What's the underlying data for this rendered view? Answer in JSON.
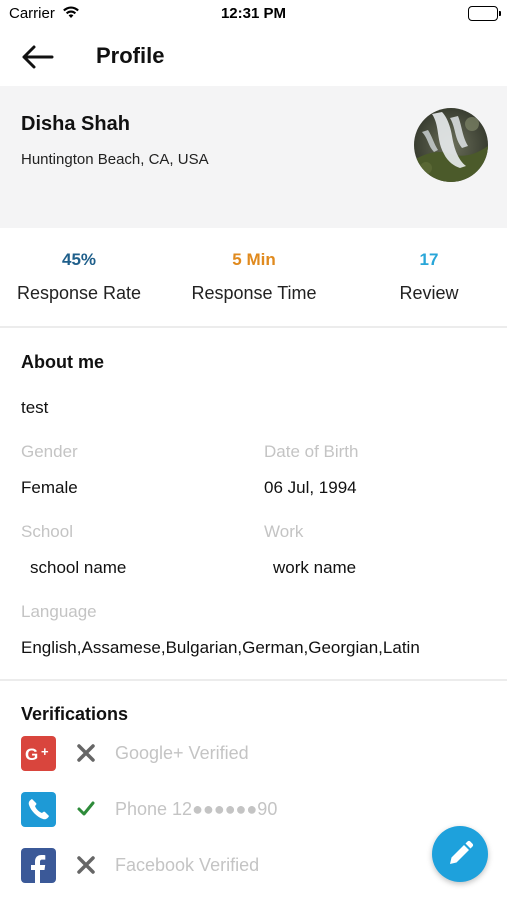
{
  "status_bar": {
    "carrier": "Carrier",
    "time": "12:31 PM"
  },
  "nav": {
    "title": "Profile"
  },
  "profile": {
    "name": "Disha Shah",
    "location": "Huntington Beach, CA, USA"
  },
  "stats": [
    {
      "value": "45%",
      "label": "Response Rate",
      "color": "#1f5f8b"
    },
    {
      "value": "5 Min",
      "label": "Response Time",
      "color": "#e08a1e"
    },
    {
      "value": "17",
      "label": "Review",
      "color": "#29a6d8"
    }
  ],
  "about": {
    "title": "About me",
    "text": "test",
    "gender_label": "Gender",
    "gender_value": "Female",
    "dob_label": "Date of Birth",
    "dob_value": "06 Jul, 1994",
    "school_label": "School",
    "school_value": "school name",
    "work_label": "Work",
    "work_value": "work name",
    "language_label": "Language",
    "language_value": "English,Assamese,Bulgarian,German,Georgian,Latin"
  },
  "verifications": {
    "title": "Verifications",
    "items": [
      {
        "icon": "google-plus-icon",
        "status": "not-verified",
        "label": "Google+ Verified"
      },
      {
        "icon": "phone-icon",
        "status": "verified",
        "label": "Phone 12●●●●●●90"
      },
      {
        "icon": "facebook-icon",
        "status": "not-verified",
        "label": "Facebook Verified"
      }
    ]
  },
  "colors": {
    "google": "#d9453d",
    "phone": "#1e9ad6",
    "facebook": "#3b5998",
    "verified_check": "#2e8b3a",
    "not_verified_x": "#666666",
    "fab": "#1ea1dc"
  }
}
